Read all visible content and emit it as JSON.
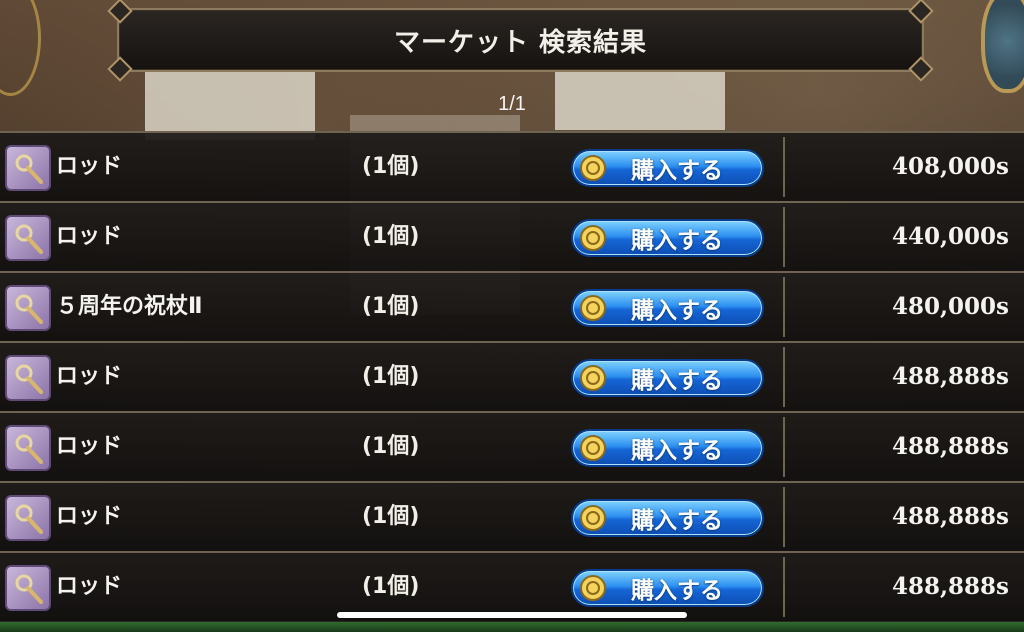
{
  "header": {
    "title": "マーケット 検索結果"
  },
  "pagination": {
    "current": "1/1"
  },
  "items": [
    {
      "name": "ロッド",
      "quantity": "(1個)",
      "buy_label": "購入する",
      "price": "408,000s",
      "icon": "rod-icon"
    },
    {
      "name": "ロッド",
      "quantity": "(1個)",
      "buy_label": "購入する",
      "price": "440,000s",
      "icon": "rod-icon"
    },
    {
      "name": "５周年の祝杖Ⅱ",
      "quantity": "(1個)",
      "buy_label": "購入する",
      "price": "480,000s",
      "icon": "rod-icon"
    },
    {
      "name": "ロッド",
      "quantity": "(1個)",
      "buy_label": "購入する",
      "price": "488,888s",
      "icon": "rod-icon"
    },
    {
      "name": "ロッド",
      "quantity": "(1個)",
      "buy_label": "購入する",
      "price": "488,888s",
      "icon": "rod-icon"
    },
    {
      "name": "ロッド",
      "quantity": "(1個)",
      "buy_label": "購入する",
      "price": "488,888s",
      "icon": "rod-icon"
    },
    {
      "name": "ロッド",
      "quantity": "(1個)",
      "buy_label": "購入する",
      "price": "488,888s",
      "icon": "rod-icon"
    }
  ],
  "colors": {
    "button_blue": "#2d8ff0",
    "item_icon_purple": "#8c74a8",
    "row_border": "#6f6352"
  }
}
